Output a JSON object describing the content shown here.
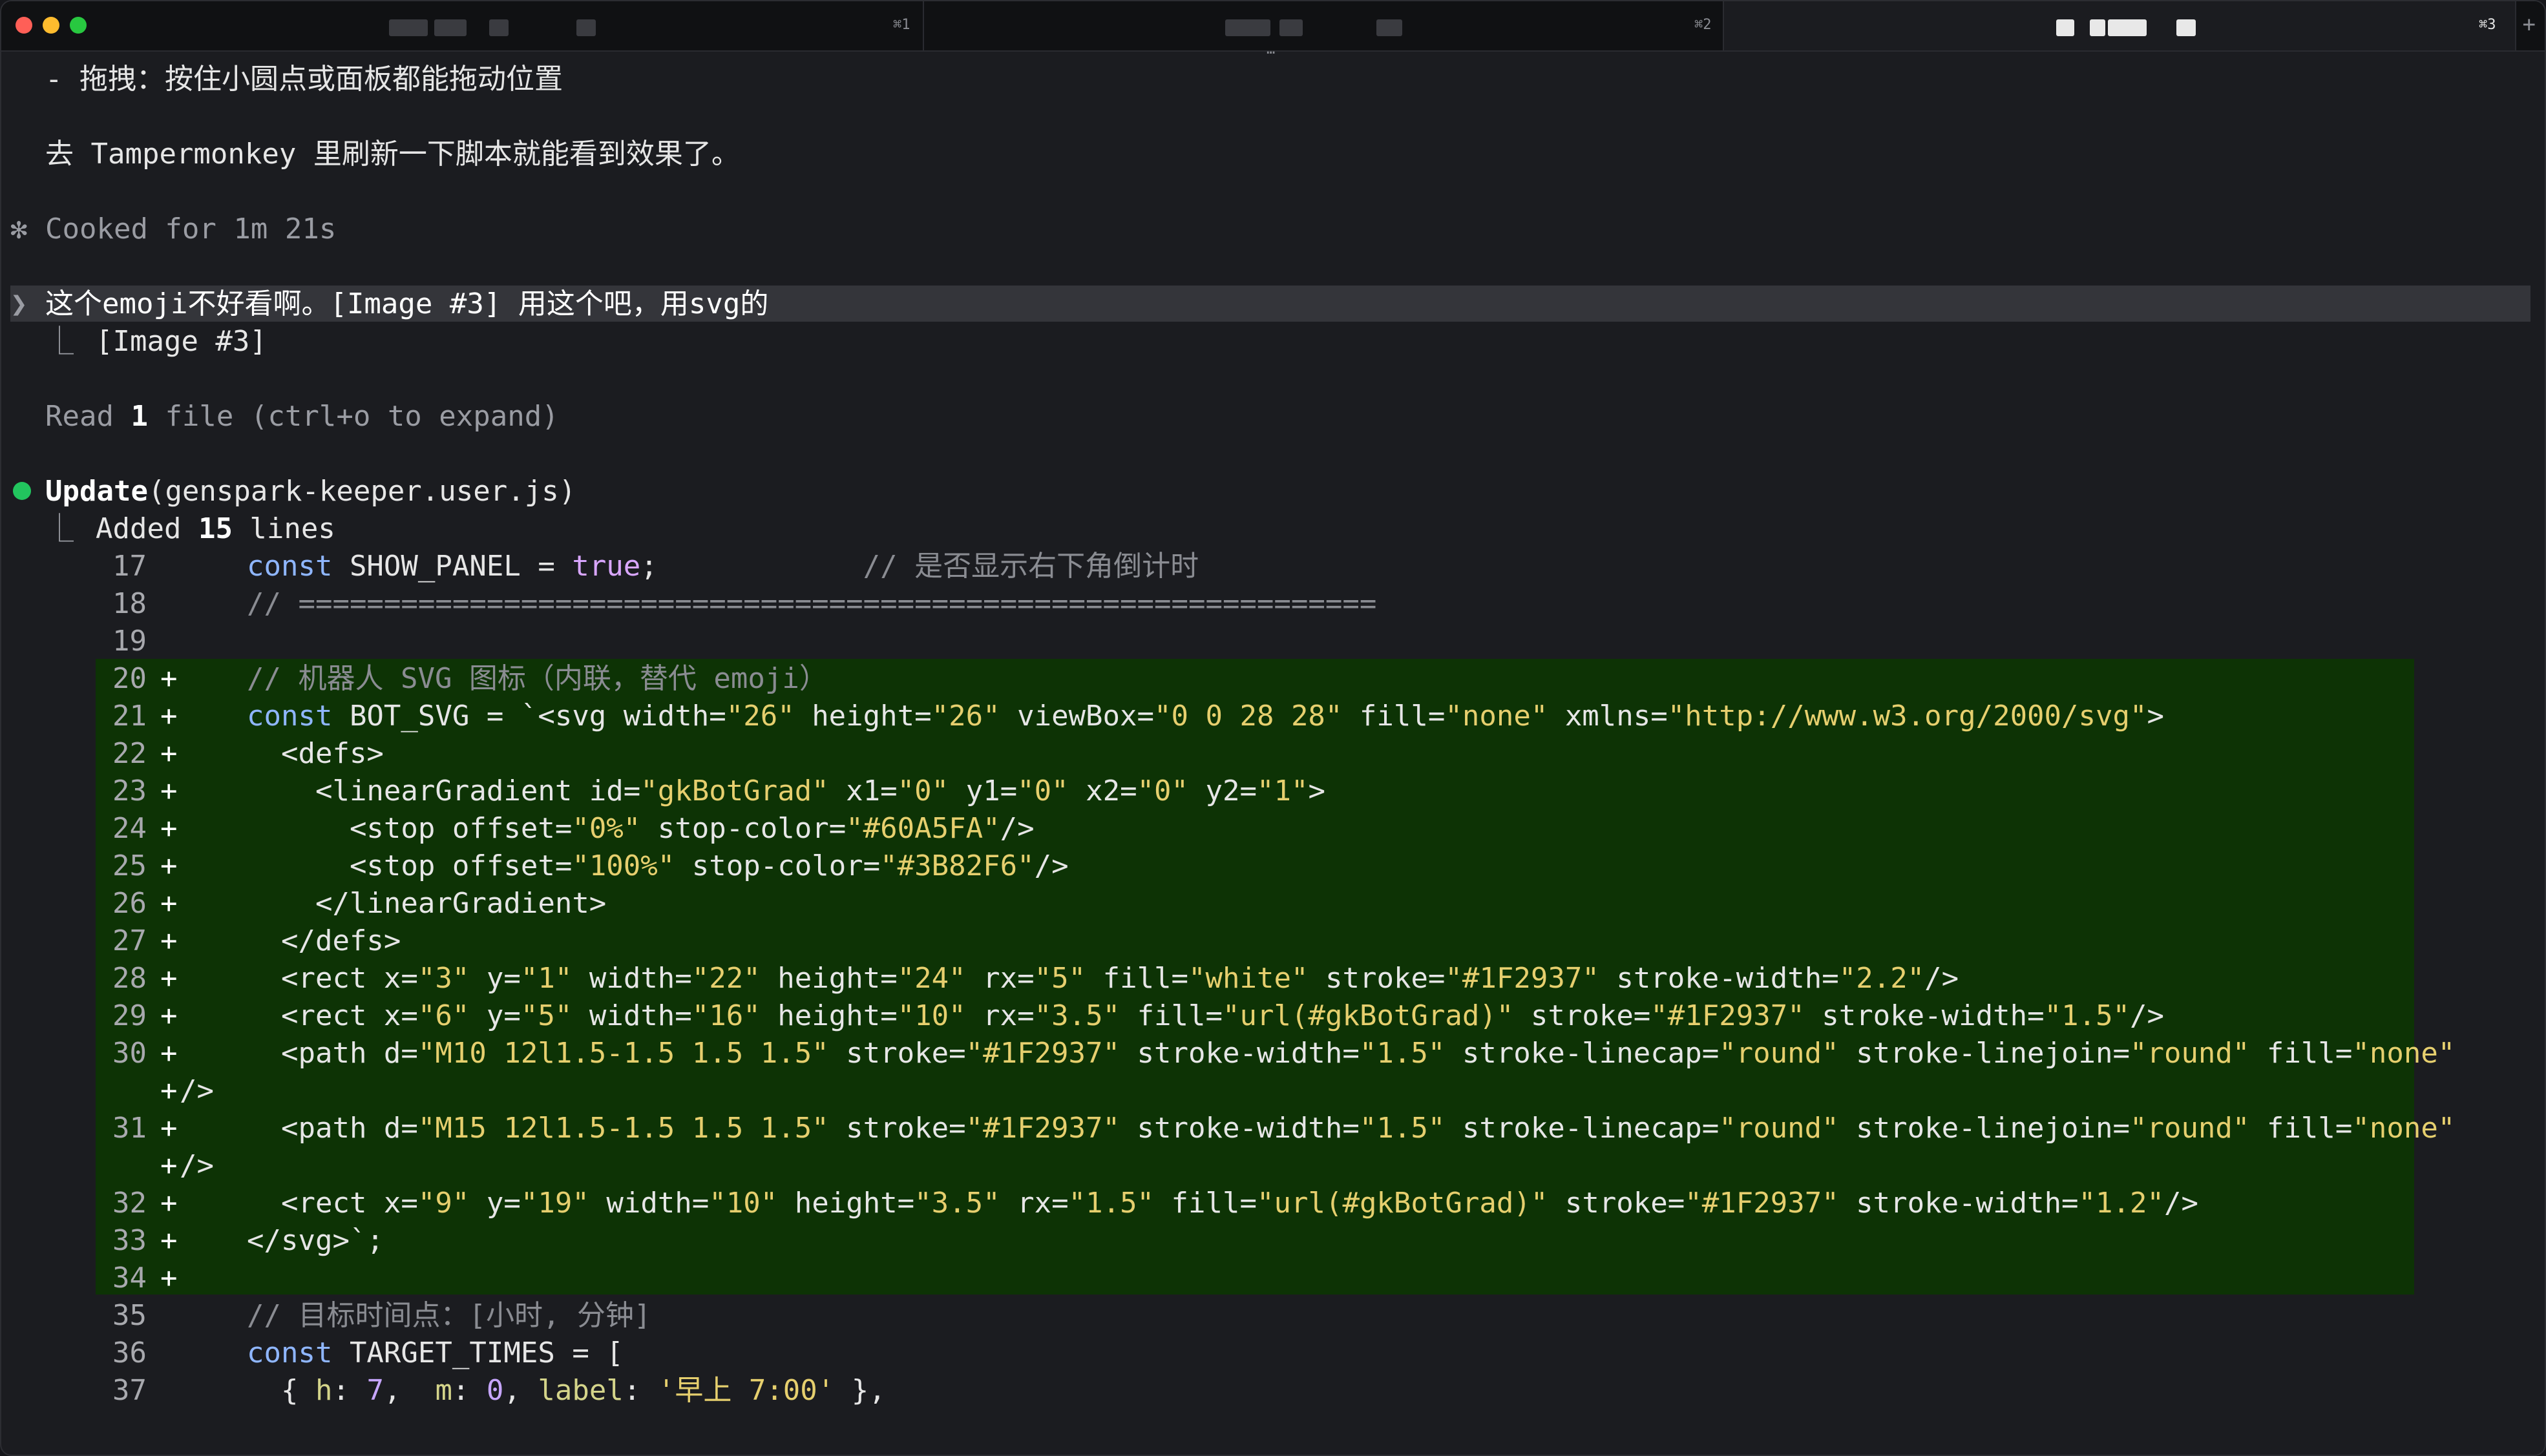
{
  "tabs": [
    {
      "shortcut": "⌘1",
      "active": false
    },
    {
      "shortcut": "⌘2",
      "active": false
    },
    {
      "shortcut": "⌘3",
      "active": true
    }
  ],
  "new_tab": "+",
  "overflow": "…",
  "colors": {
    "close": "#ff5f57",
    "minimize": "#febc2e",
    "zoom": "#28c840",
    "diff_bg": "#0d3305",
    "status_dot": "#22c55e"
  },
  "messages": {
    "drag_tip": "- 拖拽：按住小圆点或面板都能拖动位置",
    "refresh_tip": "去 Tampermonkey 里刷新一下脚本就能看到效果了。",
    "cooked_icon": "✻",
    "cooked": "Cooked for 1m 21s",
    "prompt_icon": "❯",
    "user_prompt": "这个emoji不好看啊。[Image #3] 用这个吧，用svg的",
    "branch": "⎿",
    "image_ref": "[Image #3]",
    "read_prefix": "Read ",
    "read_count": "1",
    "read_suffix": " file (ctrl+o to expand)",
    "update_label": "Update",
    "update_file": "(genspark-keeper.user.js)",
    "added_prefix": "Added ",
    "added_count": "15",
    "added_suffix": " lines"
  },
  "code_lines": [
    {
      "n": "17",
      "p": "",
      "t": "const SHOW_PANEL = true;            // 是否显示右下角倒计时"
    },
    {
      "n": "18",
      "p": "",
      "t": "// ==============================================================="
    },
    {
      "n": "19",
      "p": "",
      "t": ""
    },
    {
      "n": "20",
      "p": "+",
      "t": "// 机器人 SVG 图标（内联，替代 emoji）"
    },
    {
      "n": "21",
      "p": "+",
      "t": "const BOT_SVG = `<svg width=\"26\" height=\"26\" viewBox=\"0 0 28 28\" fill=\"none\" xmlns=\"http://www.w3.org/2000/svg\">"
    },
    {
      "n": "22",
      "p": "+",
      "t": "  <defs>"
    },
    {
      "n": "23",
      "p": "+",
      "t": "    <linearGradient id=\"gkBotGrad\" x1=\"0\" y1=\"0\" x2=\"0\" y2=\"1\">"
    },
    {
      "n": "24",
      "p": "+",
      "t": "      <stop offset=\"0%\" stop-color=\"#60A5FA\"/>"
    },
    {
      "n": "25",
      "p": "+",
      "t": "      <stop offset=\"100%\" stop-color=\"#3B82F6\"/>"
    },
    {
      "n": "26",
      "p": "+",
      "t": "    </linearGradient>"
    },
    {
      "n": "27",
      "p": "+",
      "t": "  </defs>"
    },
    {
      "n": "28",
      "p": "+",
      "t": "  <rect x=\"3\" y=\"1\" width=\"22\" height=\"24\" rx=\"5\" fill=\"white\" stroke=\"#1F2937\" stroke-width=\"2.2\"/>"
    },
    {
      "n": "29",
      "p": "+",
      "t": "  <rect x=\"6\" y=\"5\" width=\"16\" height=\"10\" rx=\"3.5\" fill=\"url(#gkBotGrad)\" stroke=\"#1F2937\" stroke-width=\"1.5\"/>"
    },
    {
      "n": "30",
      "p": "+",
      "t": "  <path d=\"M10 12l1.5-1.5 1.5 1.5\" stroke=\"#1F2937\" stroke-width=\"1.5\" stroke-linecap=\"round\" stroke-linejoin=\"round\" fill=\"none\""
    },
    {
      "n": "",
      "p": "+",
      "t": "/>",
      "wrap": true
    },
    {
      "n": "31",
      "p": "+",
      "t": "  <path d=\"M15 12l1.5-1.5 1.5 1.5\" stroke=\"#1F2937\" stroke-width=\"1.5\" stroke-linecap=\"round\" stroke-linejoin=\"round\" fill=\"none\""
    },
    {
      "n": "",
      "p": "+",
      "t": "/>",
      "wrap": true
    },
    {
      "n": "32",
      "p": "+",
      "t": "  <rect x=\"9\" y=\"19\" width=\"10\" height=\"3.5\" rx=\"1.5\" fill=\"url(#gkBotGrad)\" stroke=\"#1F2937\" stroke-width=\"1.2\"/>"
    },
    {
      "n": "33",
      "p": "+",
      "t": "</svg>`;"
    },
    {
      "n": "34",
      "p": "+",
      "t": ""
    },
    {
      "n": "35",
      "p": "",
      "t": "// 目标时间点：[小时, 分钟]"
    },
    {
      "n": "36",
      "p": "",
      "t": "const TARGET_TIMES = ["
    },
    {
      "n": "37",
      "p": "",
      "t": "  { h: 7,  m: 0, label: '早上 7:00' },"
    }
  ]
}
